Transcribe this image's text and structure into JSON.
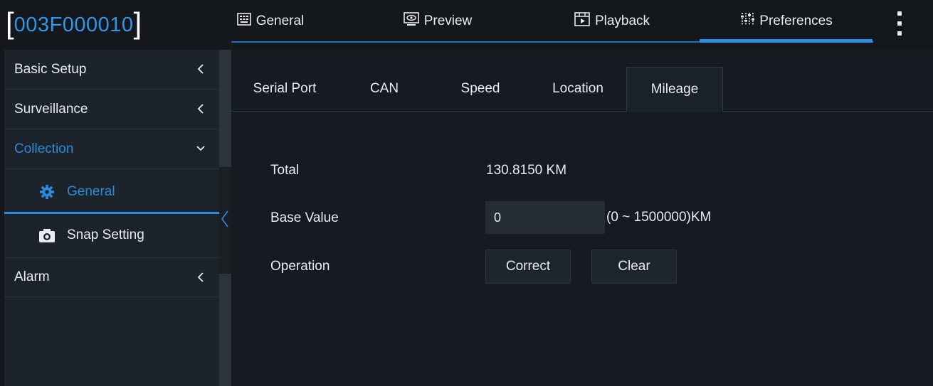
{
  "device": {
    "open_bracket": "[",
    "id": "003F000010",
    "close_bracket": "]"
  },
  "nav": {
    "tabs": [
      {
        "label": "General",
        "icon": "keyboard-icon"
      },
      {
        "label": "Preview",
        "icon": "eye-icon"
      },
      {
        "label": "Playback",
        "icon": "playback-icon"
      },
      {
        "label": "Preferences",
        "icon": "sliders-icon",
        "active": true
      }
    ],
    "more_icon": "more-vertical-icon"
  },
  "sidebar": {
    "items": [
      {
        "label": "Basic Setup",
        "state": "collapsed"
      },
      {
        "label": "Surveillance",
        "state": "collapsed"
      },
      {
        "label": "Collection",
        "state": "expanded",
        "active": true
      },
      {
        "label": "Alarm",
        "state": "collapsed"
      }
    ],
    "subitems": [
      {
        "label": "General",
        "icon": "gear-icon",
        "selected": true
      },
      {
        "label": "Snap Setting",
        "icon": "camera-icon"
      }
    ]
  },
  "subtabs": [
    {
      "label": "Serial Port"
    },
    {
      "label": "CAN"
    },
    {
      "label": "Speed"
    },
    {
      "label": "Location"
    },
    {
      "label": "Mileage",
      "active": true
    }
  ],
  "form": {
    "total_label": "Total",
    "total_value": "130.8150 KM",
    "base_label": "Base Value",
    "base_value": "0",
    "base_range": "(0 ~ 1500000)KM",
    "operation_label": "Operation",
    "correct_label": "Correct",
    "clear_label": "Clear"
  },
  "colors": {
    "accent": "#2a8de0",
    "device_id": "#2f97e6",
    "background": "#161b21",
    "sidebar": "#1d232a",
    "text": "#e8ebef"
  }
}
